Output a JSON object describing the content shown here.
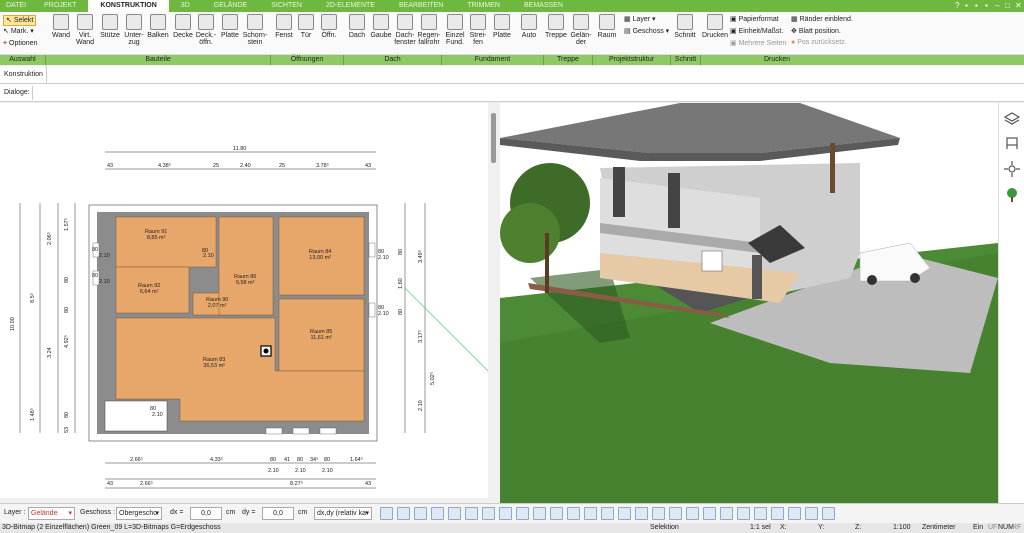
{
  "menu_tabs": [
    "DATEI",
    "PROJEKT",
    "KONSTRUKTION",
    "3D",
    "GELÄNDE",
    "SICHTEN",
    "2D-ELEMENTE",
    "BEARBEITEN",
    "TRIMMEN",
    "BEMASSEN"
  ],
  "left_controls": {
    "selekt": "Selekt",
    "mark": "Mark.",
    "optionen": "Optionen"
  },
  "ribbon_buttons": [
    {
      "label": "Wand",
      "icon": "wall-icon"
    },
    {
      "label": "Virt.\nWand",
      "icon": "virtual-wall-icon"
    },
    {
      "label": "Stütze",
      "icon": "column-icon"
    },
    {
      "label": "Unter-\nzug",
      "icon": "beam-icon"
    },
    {
      "label": "Balken",
      "icon": "girder-icon"
    },
    {
      "label": "Decke",
      "icon": "ceiling-icon"
    },
    {
      "label": "Deck.-\nöffn.",
      "icon": "ceiling-opening-icon"
    },
    {
      "label": "Platte",
      "icon": "slab-icon"
    },
    {
      "label": "Schorn-\nstein",
      "icon": "chimney-icon"
    },
    {
      "label": "Fenst",
      "icon": "window-icon"
    },
    {
      "label": "Tür",
      "icon": "door-icon"
    },
    {
      "label": "Öffn.",
      "icon": "opening-icon"
    },
    {
      "label": "Dach",
      "icon": "roof-icon"
    },
    {
      "label": "Gaube",
      "icon": "dormer-icon"
    },
    {
      "label": "Dach-\nfenster",
      "icon": "roof-window-icon"
    },
    {
      "label": "Regen-\nfallrohr",
      "icon": "downpipe-icon"
    },
    {
      "label": "Einzel\nFund.",
      "icon": "single-foundation-icon"
    },
    {
      "label": "Strei-\nfen",
      "icon": "strip-foundation-icon"
    },
    {
      "label": "Platte",
      "icon": "foundation-slab-icon"
    },
    {
      "label": "Auto",
      "icon": "auto-stair-icon"
    },
    {
      "label": "Treppe",
      "icon": "stair-icon"
    },
    {
      "label": "Gelän-\nder",
      "icon": "railing-icon"
    },
    {
      "label": "Raum",
      "icon": "room-icon"
    },
    {
      "label": "Schnitt",
      "icon": "section-icon"
    },
    {
      "label": "Drucken",
      "icon": "printer-icon"
    }
  ],
  "layer_menu": {
    "layer": "Layer",
    "geschoss": "Geschoss"
  },
  "print_options": {
    "papierformat": "Papierformat",
    "einheit": "Einheit/Maßst.",
    "mehrere": "Mehrere Seiten",
    "raender": "Ränder einblend.",
    "blatt": "Blatt position.",
    "pos": "Pos zurücksetz."
  },
  "groups": [
    "Auswahl",
    "Bauteile",
    "Öffnungen",
    "Dach",
    "Fundament",
    "Treppe",
    "Projektstruktur",
    "Schnitt",
    "Drucken"
  ],
  "konstruktion_label": "Konstruktion",
  "dialoge_label": "Dialoge:",
  "plan": {
    "rooms": [
      {
        "name": "Raum 91",
        "area": "8,85 m²"
      },
      {
        "name": "Raum 92",
        "area": "6,64 m²"
      },
      {
        "name": "Raum 90",
        "area": "2,07 m²"
      },
      {
        "name": "Raum 86",
        "area": "9,98 m²"
      },
      {
        "name": "Raum 84",
        "area": "13,00 m²"
      },
      {
        "name": "Raum 85",
        "area": "11,61 m²"
      },
      {
        "name": "Raum 83",
        "area": "36,53 m²"
      }
    ],
    "dims_top": [
      "11.80",
      "4.38⁵",
      "2.40",
      "3.78⁵",
      "43",
      "43",
      "25",
      "25"
    ],
    "dims_bottom": [
      "2.66⁵",
      "4.33⁵",
      "80",
      "80",
      "80",
      "1.64⁵",
      "2.10",
      "2.10",
      "2.10",
      "2.66⁵",
      "8.27⁵",
      "43",
      "43",
      "41",
      "34⁵"
    ],
    "dims_left": [
      "10.00",
      "8.5⁵",
      "2.06⁵",
      "1.57⁵",
      "4.92⁵",
      "3.24",
      "1.48⁵",
      "53",
      "80",
      "80",
      "80"
    ],
    "dims_right": [
      "3.49⁵",
      "3.17⁵",
      "5.02⁵",
      "1.60",
      "2.10",
      "80",
      "80"
    ],
    "door_labels": [
      "80",
      "2.10",
      "80",
      "2.10",
      "80",
      "2.10",
      "80",
      "2.10",
      "80",
      "2.10",
      "80",
      "2.10"
    ]
  },
  "statusbar": {
    "layer_label": "Layer :",
    "layer_value": "Gelände",
    "geschoss_label": "Geschoss :",
    "geschoss_value": "Obergescho",
    "dx_label": "dx =",
    "dx_value": "0,0",
    "dy_label": "dy =",
    "dy_value": "0,0",
    "unit": "cm",
    "mode": "dx,dy (relativ ka"
  },
  "infobar": {
    "left": "3D-Bitmap (2 Einzelflächen) Green_09 L=3D-Bitmaps G=Erdgeschoss",
    "selektion": "Selektion",
    "sel": "1:1 sel",
    "x": "X:",
    "y": "Y:",
    "z": "Z:",
    "scale": "1:100",
    "unit": "Zentimeter",
    "ein": "Ein",
    "uf": "UF",
    "num": "NUM",
    "rf": "RF"
  },
  "colors": {
    "accent": "#6fb83f",
    "group": "#8fc965",
    "floor": "#e8a76a",
    "wall": "#777777",
    "grass": "#4c8a35"
  }
}
